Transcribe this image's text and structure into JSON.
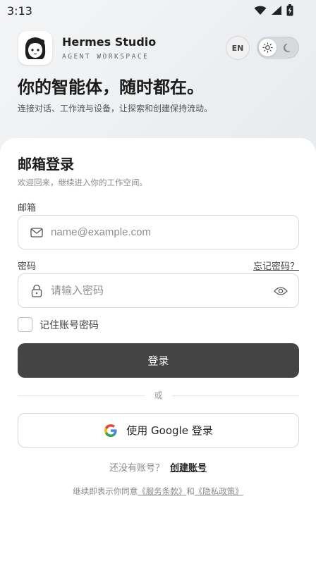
{
  "status_bar": {
    "time": "3:13",
    "icons": [
      "wifi-icon",
      "cell-signal-icon",
      "battery-charging-icon"
    ]
  },
  "brand": {
    "name": "Hermes Studio",
    "subtitle": "AGENT WORKSPACE",
    "logo": "avatar-logo"
  },
  "header": {
    "lang_label": "EN",
    "theme": {
      "active": "light",
      "options": [
        "sun-icon",
        "moon-icon"
      ]
    }
  },
  "hero": {
    "title": "你的智能体，随时都在。",
    "subtitle": "连接对话、工作流与设备，让探索和创建保持流动。"
  },
  "login": {
    "title": "邮箱登录",
    "subtitle": "欢迎回来，继续进入你的工作空间。",
    "email_label": "邮箱",
    "email_placeholder": "name@example.com",
    "password_label": "密码",
    "forgot_label": "忘记密码？",
    "password_placeholder": "请输入密码",
    "remember_label": "记住账号密码",
    "remember_checked": false,
    "submit_label": "登录",
    "divider_text": "或",
    "google_label": "使用 Google 登录",
    "no_account_text": "还没有账号？",
    "create_account_label": "创建账号",
    "terms_prefix": "继续即表示你同意",
    "terms_link": "《服务条款》",
    "terms_and": "和",
    "privacy_link": "《隐私政策》"
  },
  "colors": {
    "primary_button": "#444444",
    "background": "#eef0f2",
    "card": "#ffffff"
  }
}
